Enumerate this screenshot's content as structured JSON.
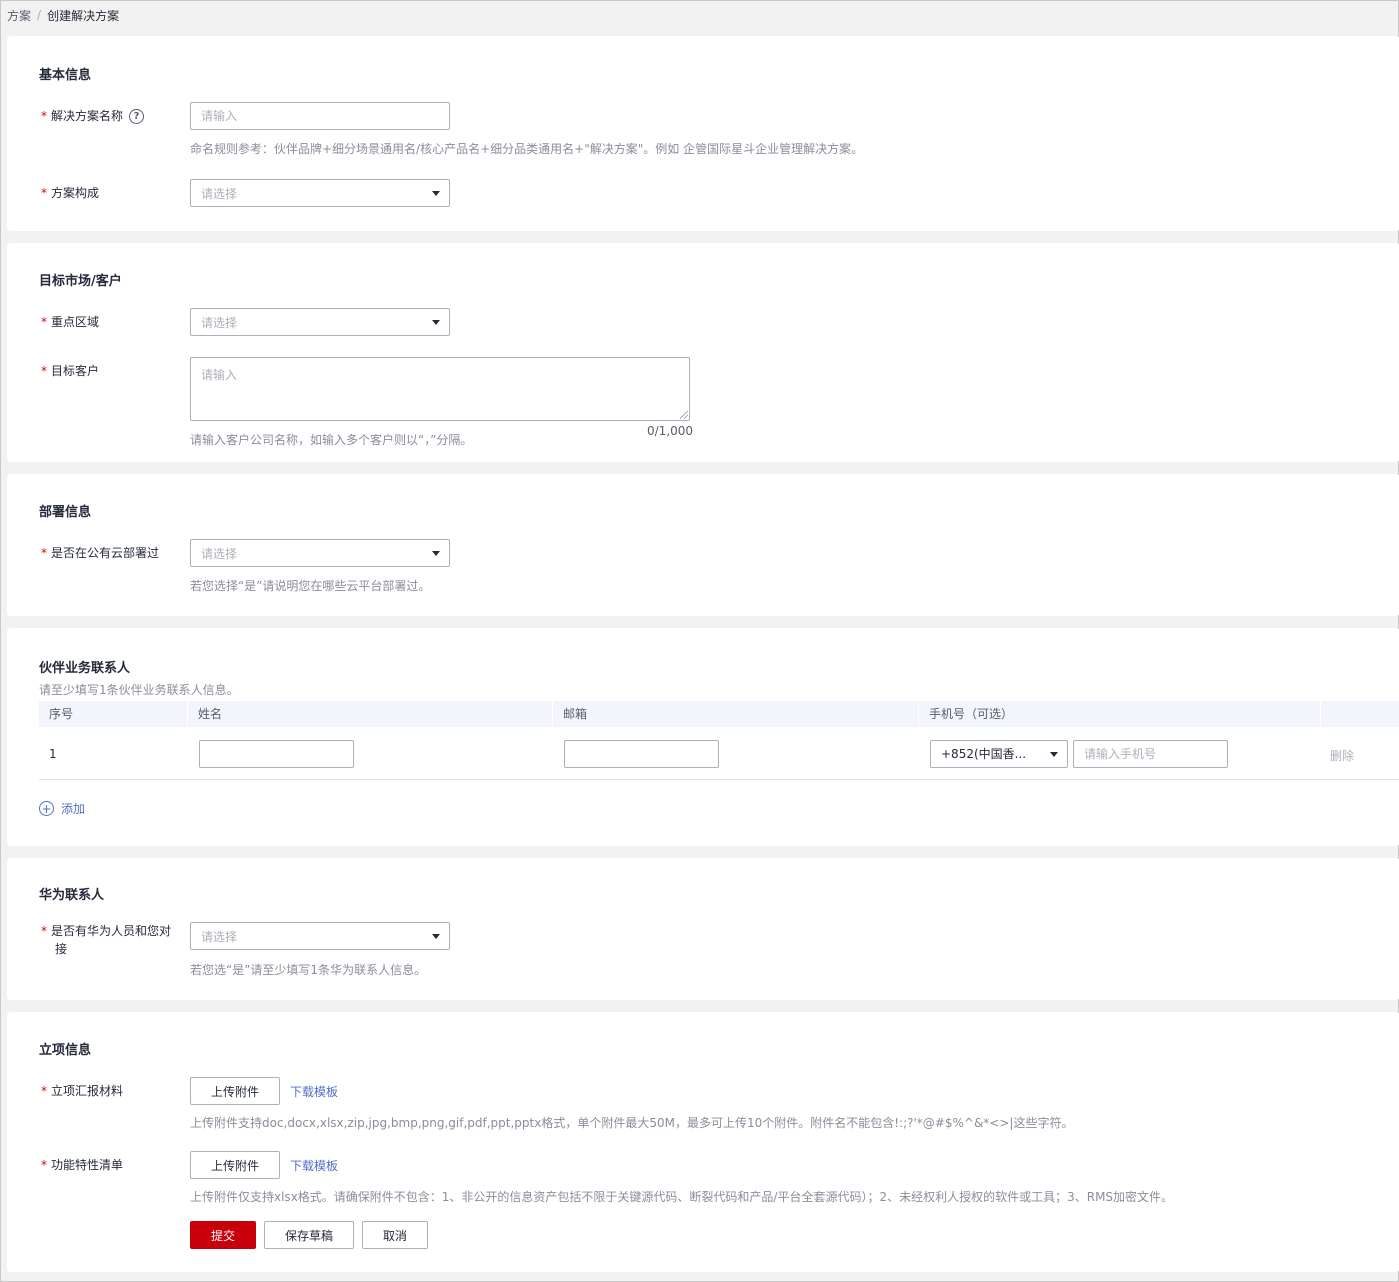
{
  "breadcrumb": {
    "parent": "方案",
    "separator": "/",
    "current": "创建解决方案"
  },
  "basic": {
    "title": "基本信息",
    "name_label": "解决方案名称",
    "name_placeholder": "请输入",
    "name_hint": "命名规则参考：伙伴品牌+细分场景通用名/核心产品名+细分品类通用名+\"解决方案\"。例如 企管国际星斗企业管理解决方案。",
    "composition_label": "方案构成",
    "composition_placeholder": "请选择"
  },
  "market": {
    "title": "目标市场/客户",
    "region_label": "重点区域",
    "region_placeholder": "请选择",
    "customer_label": "目标客户",
    "customer_placeholder": "请输入",
    "counter": "0/1,000",
    "customer_hint": "请输入客户公司名称，如输入多个客户则以“，”分隔。"
  },
  "deploy": {
    "title": "部署信息",
    "cloud_label": "是否在公有云部署过",
    "cloud_placeholder": "请选择",
    "cloud_hint": "若您选择“是”请说明您在哪些云平台部署过。"
  },
  "partner": {
    "title": "伙伴业务联系人",
    "subhint": "请至少填写1条伙伴业务联系人信息。",
    "columns": [
      "序号",
      "姓名",
      "邮箱",
      "手机号（可选）"
    ],
    "row": {
      "index": "1",
      "country_code": "+852(中国香...",
      "phone_placeholder": "请输入手机号",
      "delete_label": "删除"
    },
    "add_label": "添加"
  },
  "huawei": {
    "title": "华为联系人",
    "contact_label": "是否有华为人员和您对接",
    "contact_placeholder": "请选择",
    "contact_hint": "若您选“是”请至少填写1条华为联系人信息。"
  },
  "project": {
    "title": "立项信息",
    "report_label": "立项汇报材料",
    "upload_label": "上传附件",
    "download_label": "下载模板",
    "report_hint": "上传附件支持doc,docx,xlsx,zip,jpg,bmp,png,gif,pdf,ppt,pptx格式，单个附件最大50M，最多可上传10个附件。附件名不能包含!:;?'*@#$%^&*<>|这些字符。",
    "feature_label": "功能特性清单",
    "feature_hint": "上传附件仅支持xlsx格式。请确保附件不包含：1、非公开的信息资产包括不限于关键源代码、断裂代码和产品/平台全套源代码）；2、未经权利人授权的软件或工具；3、RMS加密文件。"
  },
  "actions": {
    "submit": "提交",
    "save_draft": "保存草稿",
    "cancel": "取消"
  },
  "colors": {
    "primary": "#c7000b",
    "link": "#526ecc",
    "required": "#e0000c"
  }
}
